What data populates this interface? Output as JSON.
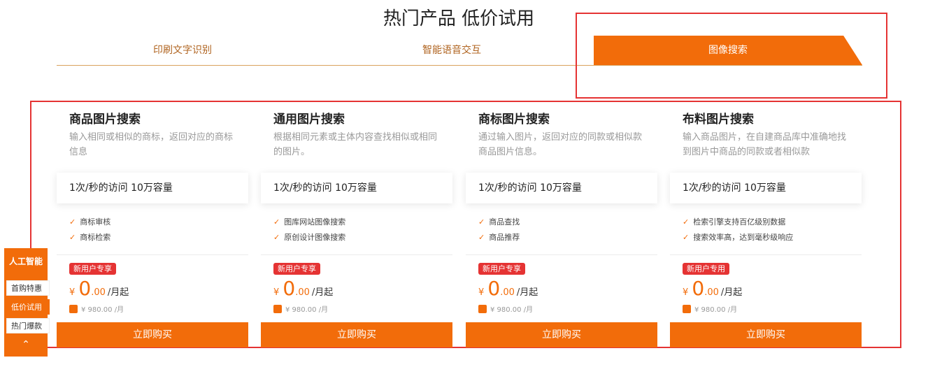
{
  "title": "热门产品 低价试用",
  "tabs": [
    {
      "label": "印刷文字识别"
    },
    {
      "label": "智能语音交互"
    },
    {
      "label": "图像搜索"
    }
  ],
  "cards": [
    {
      "title": "商品图片搜索",
      "desc": "输入相同或相似的商标，返回对应的商标信息",
      "quota": "1次/秒的访问 10万容量",
      "features": [
        "商标审核",
        "商标检索"
      ],
      "badge": "新用户专享",
      "price": {
        "currency": "¥",
        "int": "0",
        "dec": ".00",
        "unit": "/月起"
      },
      "orig": "¥ 980.00 /月",
      "buy": "立即购买"
    },
    {
      "title": "通用图片搜索",
      "desc": "根据相同元素或主体内容查找相似或相同的图片。",
      "quota": "1次/秒的访问 10万容量",
      "features": [
        "图库网站图像搜索",
        "原创设计图像搜索"
      ],
      "badge": "新用户专享",
      "price": {
        "currency": "¥",
        "int": "0",
        "dec": ".00",
        "unit": "/月起"
      },
      "orig": "¥ 980.00 /月",
      "buy": "立即购买"
    },
    {
      "title": "商标图片搜索",
      "desc": "通过输入图片，返回对应的同款或相似款商品图片信息。",
      "quota": "1次/秒的访问 10万容量",
      "features": [
        "商品查找",
        "商品推荐"
      ],
      "badge": "新用户专享",
      "price": {
        "currency": "¥",
        "int": "0",
        "dec": ".00",
        "unit": "/月起"
      },
      "orig": "¥ 980.00 /月",
      "buy": "立即购买"
    },
    {
      "title": "布料图片搜索",
      "desc": "输入商品图片，在自建商品库中准确地找到图片中商品的同款或者相似款",
      "quota": "1次/秒的访问 10万容量",
      "features": [
        "检索引擎支持百亿级别数据",
        "搜索效率高，达到毫秒级响应"
      ],
      "badge": "新用户专用",
      "price": {
        "currency": "¥",
        "int": "0",
        "dec": ".00",
        "unit": "/月起"
      },
      "orig": "¥ 980.00 /月",
      "buy": "立即购买"
    }
  ],
  "sidebar": {
    "heading": "人工智能",
    "items": [
      {
        "label": "首购特惠"
      },
      {
        "label": "低价试用"
      },
      {
        "label": "热门爆款"
      }
    ],
    "up_icon": "chevron-up-icon"
  },
  "colors": {
    "accent": "#f26c0a",
    "highlight": "#e53333",
    "badge": "#e53333"
  }
}
